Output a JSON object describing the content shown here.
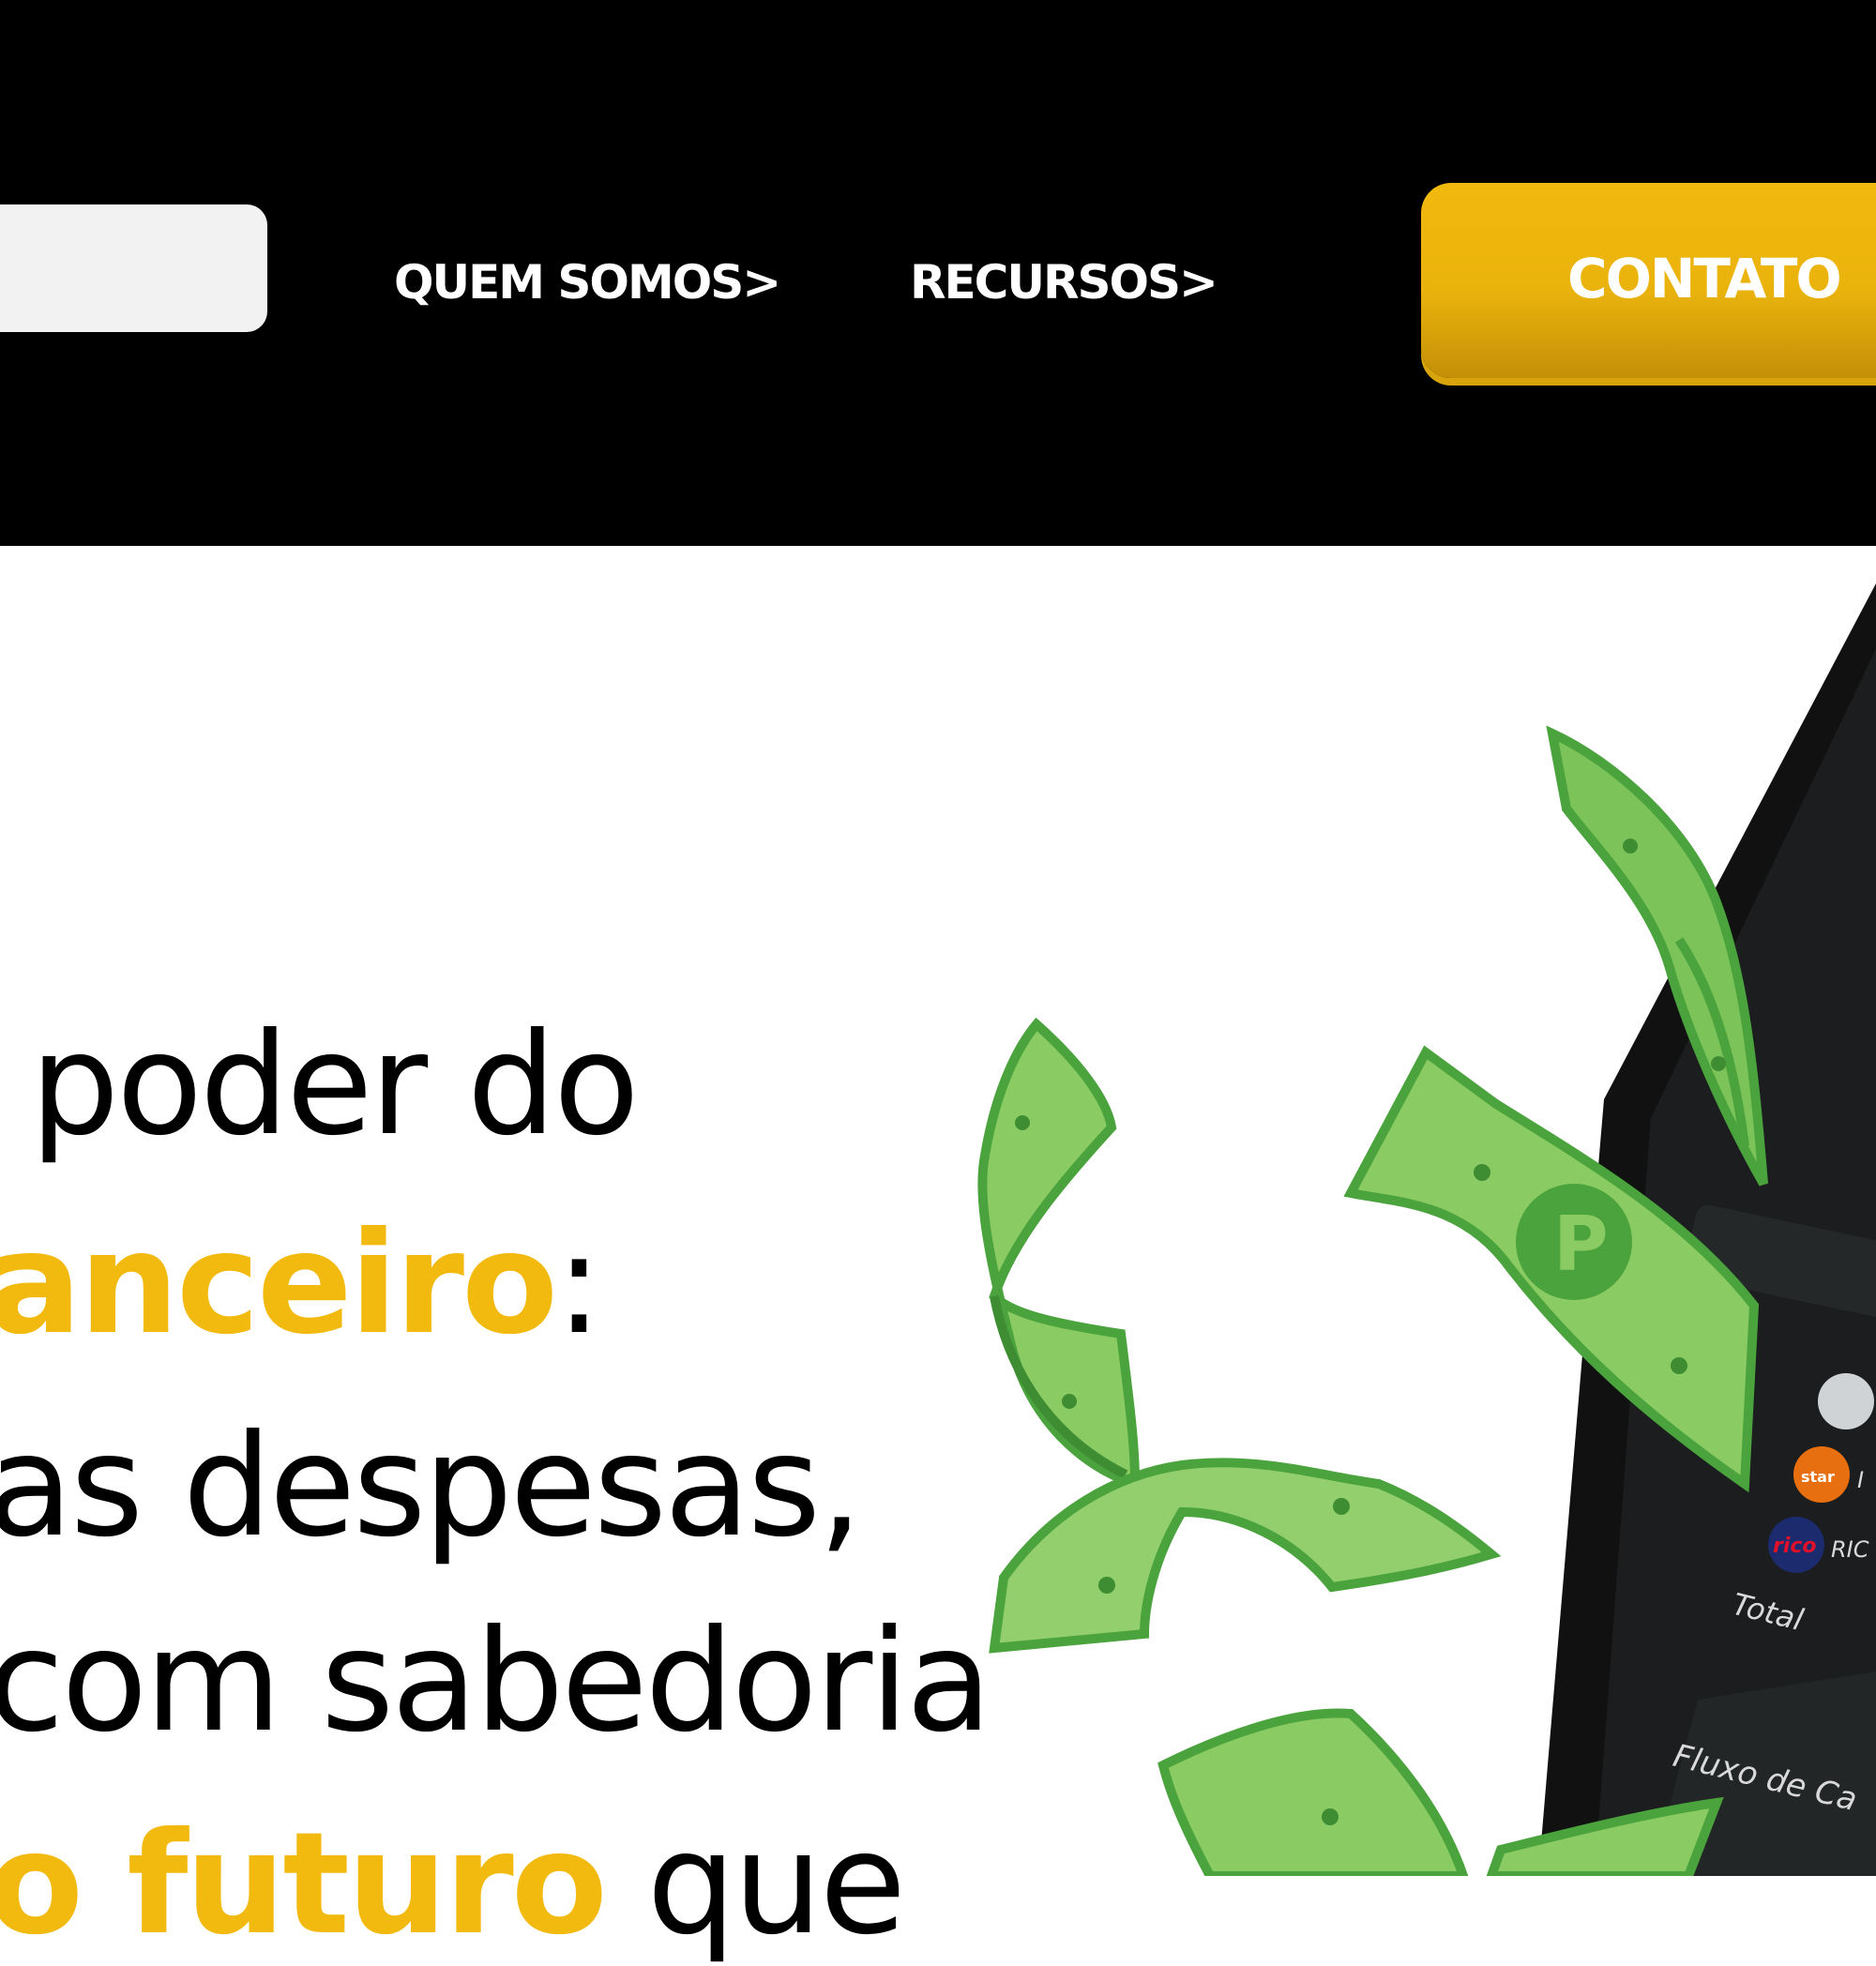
{
  "header": {
    "nav": {
      "quem_somos": "QUEM SOMOS>",
      "recursos": "RECURSOS>"
    },
    "cta_label": "CONTATO",
    "accent_color": "#f2b90e",
    "background_color": "#000000"
  },
  "hero": {
    "line1": "poder do",
    "line2_highlight": "anceiro",
    "line2_rest": ":",
    "line3": "as despesas,",
    "line4": "com sabedoria",
    "line5_highlight": "o futuro",
    "line5_rest": " que"
  },
  "phone": {
    "row_labels": [
      "Total",
      "Fluxo de Ca"
    ],
    "brand_badges": [
      "star",
      "rico"
    ],
    "brand_texts": [
      "I",
      "RIC"
    ]
  },
  "icons": [
    "money-bill-icon",
    "coin-p-icon"
  ]
}
